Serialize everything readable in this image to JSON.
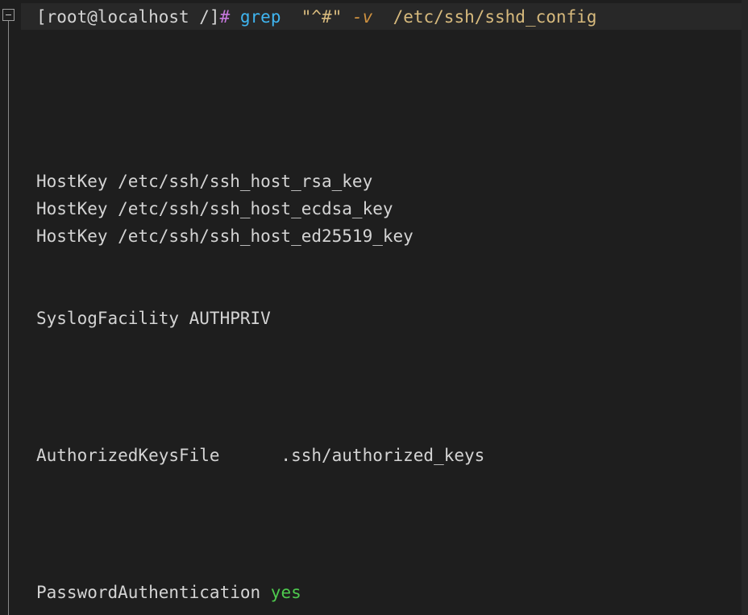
{
  "prompt": {
    "user_host": "[root@localhost /]",
    "symbol": "#",
    "command": "grep",
    "pattern": "\"^#\"",
    "flag": "-v",
    "path": "/etc/ssh/sshd_config"
  },
  "output": {
    "hostkey_rsa": "HostKey /etc/ssh/ssh_host_rsa_key",
    "hostkey_ecdsa": "HostKey /etc/ssh/ssh_host_ecdsa_key",
    "hostkey_ed25519": "HostKey /etc/ssh/ssh_host_ed25519_key",
    "syslog_facility": "SyslogFacility AUTHPRIV",
    "authorized_keys": "AuthorizedKeysFile      .ssh/authorized_keys",
    "password_auth_key": "PasswordAuthentication ",
    "password_auth_value": "yes"
  },
  "icons": {
    "fold": "collapse-icon"
  },
  "colors": {
    "background": "#1e1e1e",
    "text": "#d4d4d4",
    "prompt_symbol": "#c678dd",
    "command": "#3fb5f0",
    "string": "#d7ba7d",
    "flag": "#ce9140",
    "value_yes": "#4ec94e"
  }
}
